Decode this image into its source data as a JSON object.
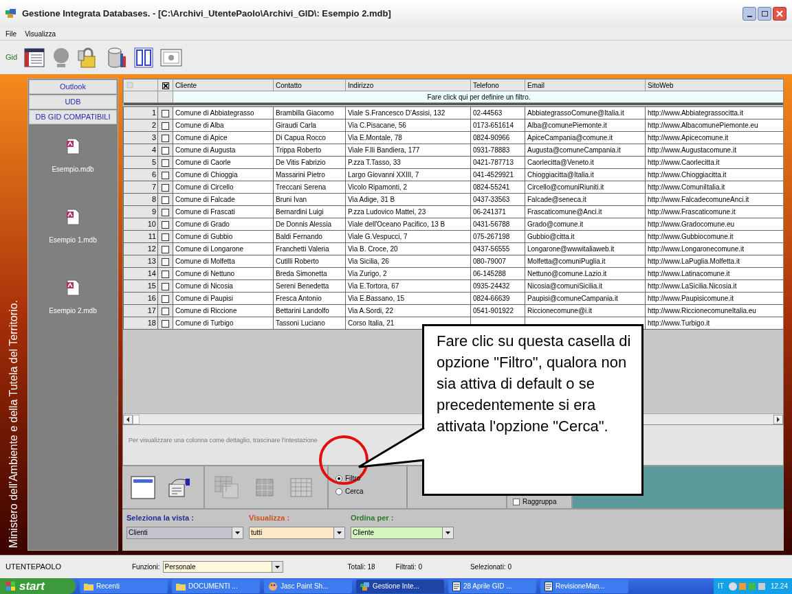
{
  "window": {
    "title": "Gestione Integrata Databases. - [C:\\Archivi_UtentePaolo\\Archivi_GID\\: Esempio 2.mdb]"
  },
  "menu": [
    "File",
    "Visualizza"
  ],
  "toolbar": {
    "label": "Gid"
  },
  "sidebar": {
    "caption": "Ministero dell'Ambiente e della Tutela del Territorio.",
    "buttons": [
      "Outlook",
      "UDB",
      "DB GID COMPATIBILI"
    ],
    "files": [
      "Esempio.mdb",
      "Esempio 1.mdb",
      "Esempio 2.mdb"
    ]
  },
  "grid": {
    "columns": [
      "Cliente",
      "Contatto",
      "Indirizzo",
      "Telefono",
      "Email",
      "SitoWeb"
    ],
    "select_all_checked": true,
    "filter_hint": "Fare click qui per definire un filtro.",
    "rows": [
      {
        "number": "1",
        "checked": false,
        "cliente": "Comune di Abbiategrasso",
        "contatto": "Brambilla Giacomo",
        "indirizzo": "Viale S.Francesco D'Assisi, 132",
        "telefono": "02-44563",
        "email": "AbbiategrassoComune@Italia.it",
        "sito": "http://www.Abbiategrassocitta.it"
      },
      {
        "number": "2",
        "checked": false,
        "cliente": "Comune di Alba",
        "contatto": "Giraudi Carla",
        "indirizzo": "Via C.Pisacane, 56",
        "telefono": "0173-651614",
        "email": "Alba@comunePiemonte.it",
        "sito": "http://www.AlbacomunePiemonte.eu"
      },
      {
        "number": "3",
        "checked": false,
        "cliente": "Comune di Apice",
        "contatto": "Di Capua Rocco",
        "indirizzo": "Via E.Montale, 78",
        "telefono": "0824-90966",
        "email": "ApiceCampania@comune.it",
        "sito": "http://www.Apicecomune.it"
      },
      {
        "number": "4",
        "checked": false,
        "cliente": "Comune di Augusta",
        "contatto": "Trippa Roberto",
        "indirizzo": "Viale F.lli Bandiera, 177",
        "telefono": "0931-78883",
        "email": "Augusta@comuneCampania.it",
        "sito": "http://www.Augustacomune.it"
      },
      {
        "number": "5",
        "checked": false,
        "cliente": "Comune di Caorle",
        "contatto": "De Vitis Fabrizio",
        "indirizzo": "P.zza T.Tasso, 33",
        "telefono": "0421-787713",
        "email": "Caorlecitta@Veneto.it",
        "sito": "http://www.Caorlecitta.it"
      },
      {
        "number": "6",
        "checked": false,
        "cliente": "Comune di Chioggia",
        "contatto": "Massarini Pietro",
        "indirizzo": "Largo Giovanni XXIII, 7",
        "telefono": "041-4529921",
        "email": "Chioggiacitta@Italia.it",
        "sito": "http://www.Chioggiacitta.it"
      },
      {
        "number": "7",
        "checked": false,
        "cliente": "Comune di Circello",
        "contatto": "Treccani Serena",
        "indirizzo": "Vicolo Ripamonti, 2",
        "telefono": "0824-55241",
        "email": "Circello@comuniRiuniti.it",
        "sito": "http://www.ComuniItalia.it"
      },
      {
        "number": "8",
        "checked": false,
        "cliente": "Comune di Falcade",
        "contatto": "Bruni Ivan",
        "indirizzo": "Via Adige, 31 B",
        "telefono": "0437-33563",
        "email": "Falcade@seneca.it",
        "sito": "http://www.FalcadecomuneAnci.it"
      },
      {
        "number": "9",
        "checked": false,
        "cliente": "Comune di Frascati",
        "contatto": "Bernardini Luigi",
        "indirizzo": "P.zza Ludovico Mattei, 23",
        "telefono": "06-241371",
        "email": "Frascaticomune@Anci.it",
        "sito": "http://www.Frascaticomune.it"
      },
      {
        "number": "10",
        "checked": false,
        "cliente": "Comune di Grado",
        "contatto": "De Donnis Alessia",
        "indirizzo": "Viale dell'Oceano Pacifico, 13 B",
        "telefono": "0431-56788",
        "email": "Grado@comune.it",
        "sito": "http://www.Gradocomune.eu"
      },
      {
        "number": "11",
        "checked": false,
        "cliente": "Comune di Gubbio",
        "contatto": "Baldi Fernando",
        "indirizzo": "Viale G.Vespucci, 7",
        "telefono": "075-267198",
        "email": "Gubbio@citta.it",
        "sito": "http://www.Gubbiocomune.it"
      },
      {
        "number": "12",
        "checked": false,
        "cliente": "Comune di Longarone",
        "contatto": "Franchetti Valeria",
        "indirizzo": "Via B. Croce, 20",
        "telefono": "0437-56555",
        "email": "Longarone@wwwitaliaweb.it",
        "sito": "http://www.Longaronecomune.it"
      },
      {
        "number": "13",
        "checked": false,
        "cliente": "Comune di Molfetta",
        "contatto": "Cutilli Roberto",
        "indirizzo": "Via Sicilia, 26",
        "telefono": "080-79007",
        "email": "Molfetta@comuniPuglia.it",
        "sito": "http://www.LaPuglia.Molfetta.it"
      },
      {
        "number": "14",
        "checked": false,
        "cliente": "Comune di Nettuno",
        "contatto": "Breda Simonetta",
        "indirizzo": "Via Zurigo, 2",
        "telefono": "06-145288",
        "email": "Nettuno@comune.Lazio.it",
        "sito": "http://www.Latinacomune.it"
      },
      {
        "number": "15",
        "checked": false,
        "cliente": "Comune di Nicosia",
        "contatto": "Sereni Benedetta",
        "indirizzo": "Via E.Tortora, 67",
        "telefono": "0935-24432",
        "email": "Nicosia@comuniSicilia.it",
        "sito": "http://www.LaSicilia.Nicosia.it"
      },
      {
        "number": "16",
        "checked": false,
        "cliente": "Comune di Paupisi",
        "contatto": "Fresca Antonio",
        "indirizzo": "Via E.Bassano, 15",
        "telefono": "0824-66639",
        "email": "Paupisi@comuneCampania.it",
        "sito": "http://www.Paupisicomune.it"
      },
      {
        "number": "17",
        "checked": false,
        "cliente": "Comune di Riccione",
        "contatto": "Bettarini Landolfo",
        "indirizzo": "Via A.Sordi, 22",
        "telefono": "0541-901922",
        "email": "Riccionecomune@i.it",
        "sito": "http://www.RiccionecomuneItalia.eu"
      },
      {
        "number": "18",
        "checked": false,
        "cliente": "Comune di Turbigo",
        "contatto": "Tassoni Luciano",
        "indirizzo": "Corso Italia, 21",
        "sito": "http://www.Turbigo.it"
      }
    ]
  },
  "group_hint": "Per visualizzare una colonna come dettaglio, trascinare l'intestazione",
  "options": {
    "radios": [
      {
        "label": "Filtro",
        "selected": true
      },
      {
        "label": "Cerca",
        "selected": false
      }
    ],
    "group_checkbox": {
      "label": "Raggruppa",
      "checked": false
    }
  },
  "selectors": [
    {
      "kind": "view",
      "label": "Seleziona la vista :",
      "value": "Clienti"
    },
    {
      "kind": "show",
      "label": "Visualizza :",
      "value": "tutti"
    },
    {
      "kind": "order",
      "label": "Ordina per :",
      "value": "Cliente"
    }
  ],
  "status_bar": {
    "user": "UTENTEPAOLO",
    "functions_label": "Funzioni:",
    "functions_value": "Personale",
    "totals": "Totali: 18",
    "filtered": "Filtrati: 0",
    "selected": "Selezionati: 0"
  },
  "taskbar": {
    "start": "start",
    "items": [
      {
        "kind": "folder",
        "label": "Recenti",
        "selected": false
      },
      {
        "kind": "folder",
        "label": "DOCUMENTI ...",
        "selected": false
      },
      {
        "kind": "paint",
        "label": "Jasc Paint Sh...",
        "selected": false
      },
      {
        "kind": "app",
        "label": "Gestione Inte...",
        "selected": true
      },
      {
        "kind": "doc",
        "label": "28 Aprile GID ...",
        "selected": false
      },
      {
        "kind": "doc",
        "label": "RevisioneMan...",
        "selected": false
      }
    ],
    "language": "IT",
    "clock": "12.24"
  },
  "callout": "Fare clic su questa casella di opzione \"Filtro\", qualora non sia attiva di default o se precedentemente si era attivata l'opzione \"Cerca\"."
}
